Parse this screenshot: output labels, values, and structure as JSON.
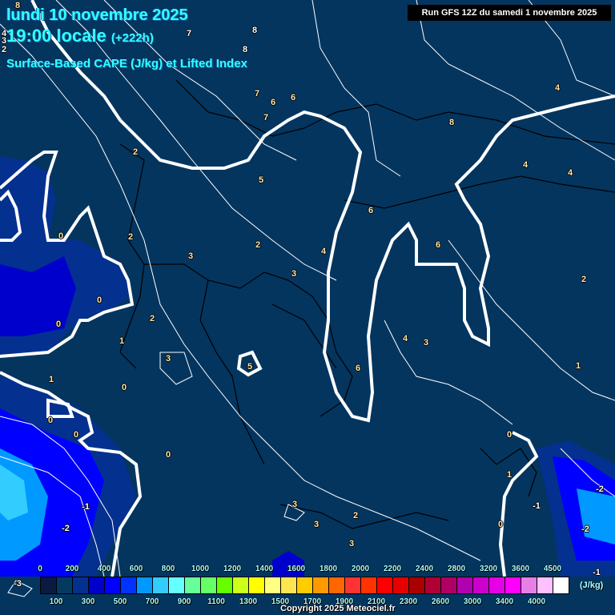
{
  "header": {
    "date": "lundi 10 novembre 2025",
    "time": "19:00 locale",
    "lead": "(+222h)",
    "title": "Surface-Based CAPE (J/kg) et Lifted Index",
    "run": "Run GFS 12Z du samedi 1 novembre 2025"
  },
  "map": {
    "background_color": "#03355f",
    "contour_labels": [
      "8",
      "7",
      "8",
      "8",
      "4",
      "3",
      "2",
      "7",
      "6",
      "6",
      "7",
      "8",
      "4",
      "2",
      "5",
      "4",
      "4",
      "6",
      "0",
      "2",
      "2",
      "3",
      "6",
      "4",
      "3",
      "2",
      "0",
      "0",
      "2",
      "1",
      "4",
      "3",
      "3",
      "5",
      "6",
      "1",
      "1",
      "0",
      "0",
      "0",
      "0",
      "0",
      "1",
      "-1",
      "-1",
      "3",
      "2",
      "3",
      "0",
      "-2",
      "-2",
      "-2",
      "3",
      "-3",
      "-1"
    ]
  },
  "legend": {
    "unit": "(J/kg)",
    "top_labels": [
      "0",
      "200",
      "400",
      "600",
      "800",
      "1000",
      "1200",
      "1400",
      "1600",
      "1800",
      "2000",
      "2200",
      "2400",
      "2800",
      "3200",
      "3600",
      "4500"
    ],
    "bottom_labels": [
      "100",
      "300",
      "500",
      "700",
      "900",
      "1100",
      "1300",
      "1500",
      "1700",
      "1900",
      "2100",
      "2300",
      "2600",
      "3000",
      "3400",
      "4000"
    ],
    "colors": [
      "#0a1a40",
      "#033a62",
      "#04308f",
      "#0000cc",
      "#0000ff",
      "#0033ff",
      "#0099ff",
      "#33ccff",
      "#66ffff",
      "#66ff99",
      "#66ff66",
      "#66ff00",
      "#ccff19",
      "#ffff00",
      "#ffff80",
      "#ffe650",
      "#ffcc00",
      "#ff9900",
      "#ff6600",
      "#ff3333",
      "#ff3300",
      "#ff0000",
      "#e60000",
      "#aa0000",
      "#b00033",
      "#b00066",
      "#b000b0",
      "#cc00cc",
      "#e600e6",
      "#ff00ff",
      "#e680e6",
      "#ffc0ff",
      "#ffffff"
    ]
  },
  "copyright": "Copyright 2025 Meteociel.fr"
}
